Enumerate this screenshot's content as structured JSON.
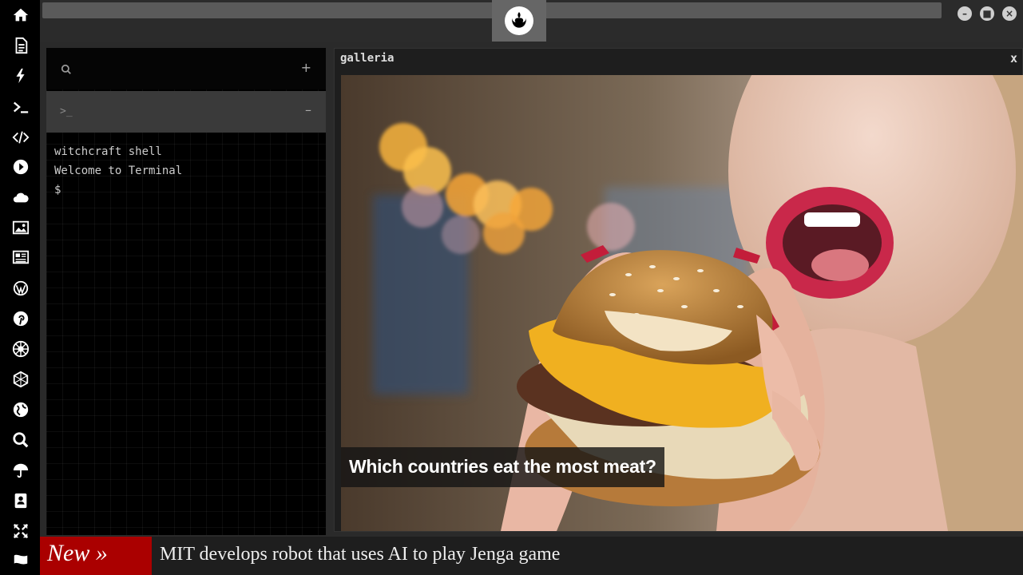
{
  "dock": {
    "items": [
      {
        "icon": "home-icon"
      },
      {
        "icon": "document-icon"
      },
      {
        "icon": "lightning-icon"
      },
      {
        "icon": "terminal-icon"
      },
      {
        "icon": "code-icon"
      },
      {
        "icon": "play-icon"
      },
      {
        "icon": "cloud-icon"
      },
      {
        "icon": "image-icon"
      },
      {
        "icon": "newspaper-icon"
      },
      {
        "icon": "wordpress-icon"
      },
      {
        "icon": "pinterest-icon"
      },
      {
        "icon": "galactic-empire-icon"
      },
      {
        "icon": "hexagon-network-icon"
      },
      {
        "icon": "globe-icon"
      },
      {
        "icon": "search-icon"
      },
      {
        "icon": "umbrella-icon"
      },
      {
        "icon": "contacts-icon"
      },
      {
        "icon": "expand-arrows-icon"
      },
      {
        "icon": "flag-icon"
      }
    ]
  },
  "topbar": {
    "logo_icon": "rebel-alliance-icon",
    "controls": [
      "minimize",
      "maximize",
      "close"
    ]
  },
  "terminal": {
    "add_label": "+",
    "tab_prompt": ">_",
    "collapse_label": "–",
    "lines": [
      "witchcraft shell",
      "Welcome to Terminal",
      "$"
    ]
  },
  "gallery": {
    "title": "galleria",
    "close_label": "x",
    "caption": "Which countries eat the most meat?"
  },
  "ticker": {
    "badge": "New »",
    "headline": "MIT develops robot that uses AI to play Jenga game"
  },
  "colors": {
    "dock_bg": "#000000",
    "ticker_badge": "#aa0000",
    "panel_bg": "#000000"
  }
}
